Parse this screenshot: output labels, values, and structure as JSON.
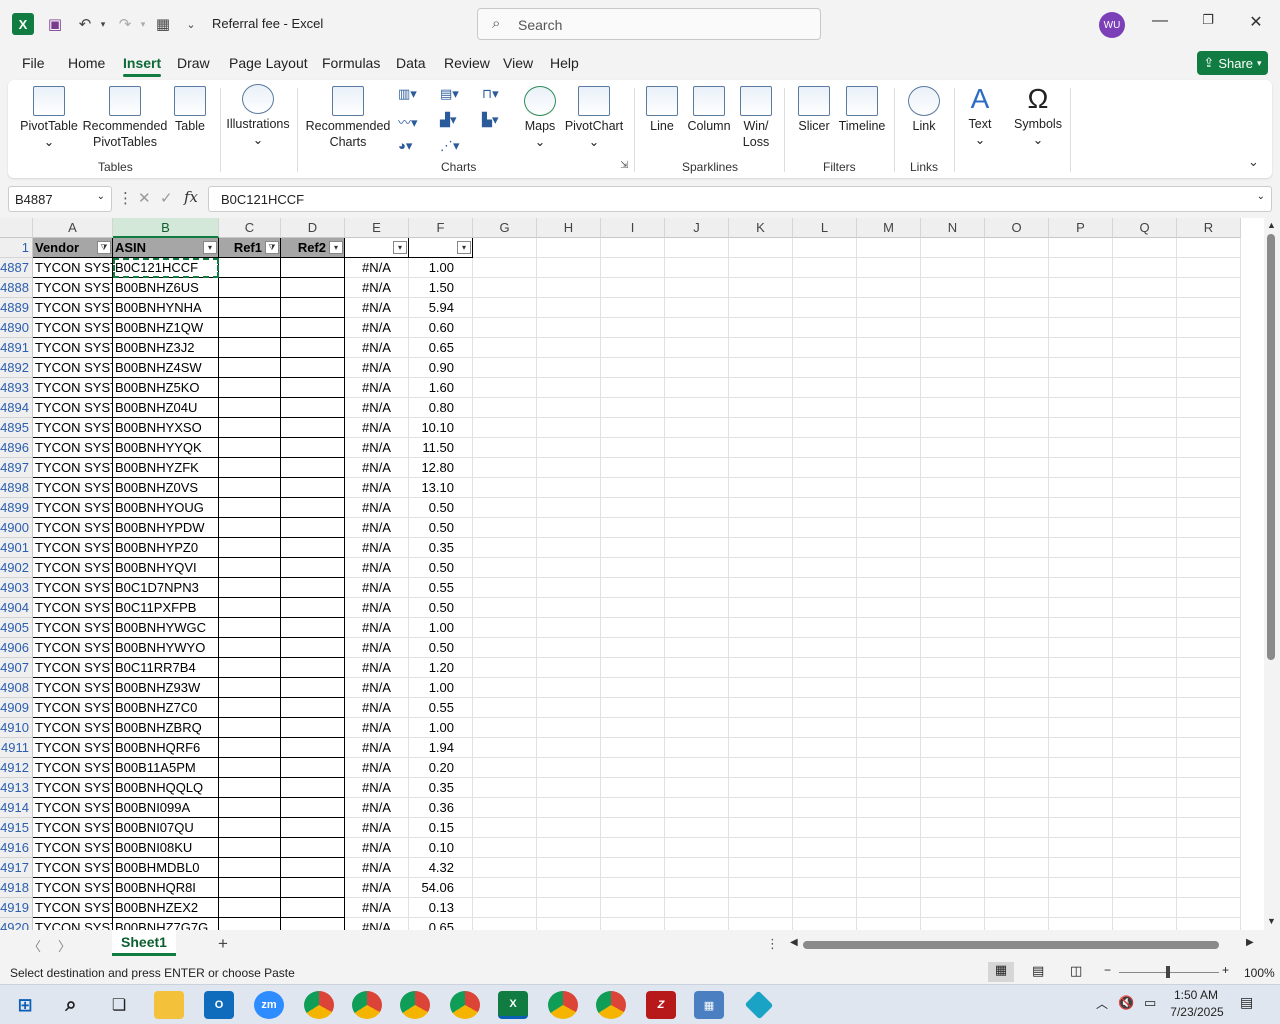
{
  "title": {
    "doc": "Referral fee  -  Excel",
    "search_placeholder": "Search",
    "avatar": "WU"
  },
  "menu": [
    "File",
    "Home",
    "Insert",
    "Draw",
    "Page Layout",
    "Formulas",
    "Data",
    "Review",
    "Help"
  ],
  "share_label": "Share",
  "ribbon": {
    "pivottable": "PivotTable",
    "recommended_pivot": "Recommended PivotTables",
    "table": "Table",
    "illustrations": "Illustrations",
    "recommended_charts": "Recommended Charts",
    "maps": "Maps",
    "pivotchart": "PivotChart",
    "line": "Line",
    "column": "Column",
    "winloss": "Win/ Loss",
    "slicer": "Slicer",
    "timeline": "Timeline",
    "link": "Link",
    "text": "Text",
    "symbols": "Symbols",
    "groups": {
      "tables": "Tables",
      "charts": "Charts",
      "sparklines": "Sparklines",
      "filters": "Filters",
      "links": "Links"
    }
  },
  "namebox": "B4887",
  "formula": "B0C121HCCF",
  "columns": [
    "A",
    "B",
    "C",
    "D",
    "E",
    "F",
    "G",
    "H",
    "I",
    "J",
    "K",
    "L",
    "M",
    "N",
    "O",
    "P",
    "Q",
    "R"
  ],
  "header_row": {
    "num": "1",
    "A": "Vendor",
    "B": "ASIN",
    "C": "Ref1",
    "D": "Ref2",
    "E": "",
    "F": ""
  },
  "rows": [
    {
      "n": "4887",
      "a": "TYCON SYSTE",
      "b": "B0C121HCCF",
      "e": "#N/A",
      "f": "1.00"
    },
    {
      "n": "4888",
      "a": "TYCON SYSTE",
      "b": "B00BNHZ6US",
      "e": "#N/A",
      "f": "1.50"
    },
    {
      "n": "4889",
      "a": "TYCON SYSTE",
      "b": "B00BNHYNHA",
      "e": "#N/A",
      "f": "5.94"
    },
    {
      "n": "4890",
      "a": "TYCON SYSTE",
      "b": "B00BNHZ1QW",
      "e": "#N/A",
      "f": "0.60"
    },
    {
      "n": "4891",
      "a": "TYCON SYSTE",
      "b": "B00BNHZ3J2",
      "e": "#N/A",
      "f": "0.65"
    },
    {
      "n": "4892",
      "a": "TYCON SYSTE",
      "b": "B00BNHZ4SW",
      "e": "#N/A",
      "f": "0.90"
    },
    {
      "n": "4893",
      "a": "TYCON SYSTE",
      "b": "B00BNHZ5KO",
      "e": "#N/A",
      "f": "1.60"
    },
    {
      "n": "4894",
      "a": "TYCON SYSTE",
      "b": "B00BNHZ04U",
      "e": "#N/A",
      "f": "0.80"
    },
    {
      "n": "4895",
      "a": "TYCON SYSTE",
      "b": "B00BNHYXSO",
      "e": "#N/A",
      "f": "10.10"
    },
    {
      "n": "4896",
      "a": "TYCON SYSTE",
      "b": "B00BNHYYQK",
      "e": "#N/A",
      "f": "11.50"
    },
    {
      "n": "4897",
      "a": "TYCON SYSTE",
      "b": "B00BNHYZFK",
      "e": "#N/A",
      "f": "12.80"
    },
    {
      "n": "4898",
      "a": "TYCON SYSTE",
      "b": "B00BNHZ0VS",
      "e": "#N/A",
      "f": "13.10"
    },
    {
      "n": "4899",
      "a": "TYCON SYSTE",
      "b": "B00BNHYOUG",
      "e": "#N/A",
      "f": "0.50"
    },
    {
      "n": "4900",
      "a": "TYCON SYSTE",
      "b": "B00BNHYPDW",
      "e": "#N/A",
      "f": "0.50"
    },
    {
      "n": "4901",
      "a": "TYCON SYSTE",
      "b": "B00BNHYPZ0",
      "e": "#N/A",
      "f": "0.35"
    },
    {
      "n": "4902",
      "a": "TYCON SYSTE",
      "b": "B00BNHYQVI",
      "e": "#N/A",
      "f": "0.50"
    },
    {
      "n": "4903",
      "a": "TYCON SYSTE",
      "b": "B0C1D7NPN3",
      "e": "#N/A",
      "f": "0.55"
    },
    {
      "n": "4904",
      "a": "TYCON SYSTE",
      "b": "B0C11PXFPB",
      "e": "#N/A",
      "f": "0.50"
    },
    {
      "n": "4905",
      "a": "TYCON SYSTE",
      "b": "B00BNHYWGC",
      "e": "#N/A",
      "f": "1.00"
    },
    {
      "n": "4906",
      "a": "TYCON SYSTE",
      "b": "B00BNHYWYO",
      "e": "#N/A",
      "f": "0.50"
    },
    {
      "n": "4907",
      "a": "TYCON SYSTE",
      "b": "B0C11RR7B4",
      "e": "#N/A",
      "f": "1.20"
    },
    {
      "n": "4908",
      "a": "TYCON SYSTE",
      "b": "B00BNHZ93W",
      "e": "#N/A",
      "f": "1.00"
    },
    {
      "n": "4909",
      "a": "TYCON SYSTE",
      "b": "B00BNHZ7C0",
      "e": "#N/A",
      "f": "0.55"
    },
    {
      "n": "4910",
      "a": "TYCON SYSTE",
      "b": "B00BNHZBRQ",
      "e": "#N/A",
      "f": "1.00"
    },
    {
      "n": "4911",
      "a": "TYCON SYSTE",
      "b": "B00BNHQRF6",
      "e": "#N/A",
      "f": "1.94"
    },
    {
      "n": "4912",
      "a": "TYCON SYSTE",
      "b": "B00B11A5PM",
      "e": "#N/A",
      "f": "0.20"
    },
    {
      "n": "4913",
      "a": "TYCON SYSTE",
      "b": "B00BNHQQLQ",
      "e": "#N/A",
      "f": "0.35"
    },
    {
      "n": "4914",
      "a": "TYCON SYSTE",
      "b": "B00BNI099A",
      "e": "#N/A",
      "f": "0.36"
    },
    {
      "n": "4915",
      "a": "TYCON SYSTE",
      "b": "B00BNI07QU",
      "e": "#N/A",
      "f": "0.15"
    },
    {
      "n": "4916",
      "a": "TYCON SYSTE",
      "b": "B00BNI08KU",
      "e": "#N/A",
      "f": "0.10"
    },
    {
      "n": "4917",
      "a": "TYCON SYSTE",
      "b": "B00BHMDBL0",
      "e": "#N/A",
      "f": "4.32"
    },
    {
      "n": "4918",
      "a": "TYCON SYSTE",
      "b": "B00BNHQR8I",
      "e": "#N/A",
      "f": "54.06"
    },
    {
      "n": "4919",
      "a": "TYCON SYSTE",
      "b": "B00BNHZEX2",
      "e": "#N/A",
      "f": "0.13"
    },
    {
      "n": "4920",
      "a": "TYCON SYSTE",
      "b": "B00BNHZ7G7G",
      "e": "#N/A",
      "f": "0.65"
    }
  ],
  "sheet_tab": "Sheet1",
  "status_text": "Select destination and press ENTER or choose Paste",
  "zoom": "100%",
  "clock": {
    "time": "1:50 AM",
    "date": "7/23/2025"
  }
}
